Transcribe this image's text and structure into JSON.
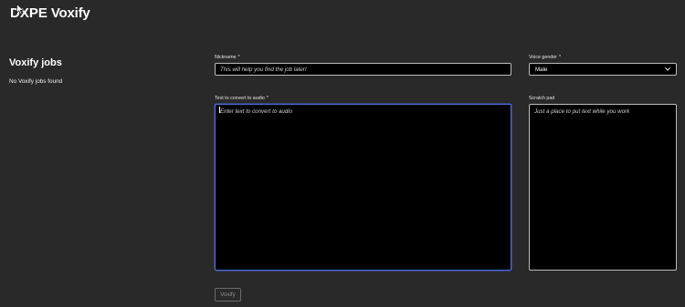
{
  "header": {
    "brand": "DXPE",
    "product": "Voxify"
  },
  "jobs_panel": {
    "title": "Voxify jobs",
    "empty_message": "No Voxify jobs found"
  },
  "form": {
    "nickname": {
      "label": "Nickname",
      "required_marker": "*",
      "placeholder": "This will help you find the job later!",
      "value": ""
    },
    "voice_gender": {
      "label": "Voice gender",
      "required_marker": "*",
      "selected": "Male",
      "icon": "chevron-down-icon"
    },
    "text_to_convert": {
      "label": "Text to convert to audio",
      "required_marker": "*",
      "placeholder": "Enter text to convert to audio",
      "value": "",
      "focused": true
    },
    "scratch_pad": {
      "label": "Scratch pad",
      "placeholder": "Just a place to put text while you work",
      "value": ""
    },
    "submit_button": {
      "label": "Voxify",
      "disabled": true
    }
  },
  "colors": {
    "background": "#292929",
    "field_background": "#000000",
    "field_border": "#bdbdbd",
    "focus_border": "#4f6bd8",
    "disabled_text": "#8f8f8f"
  }
}
